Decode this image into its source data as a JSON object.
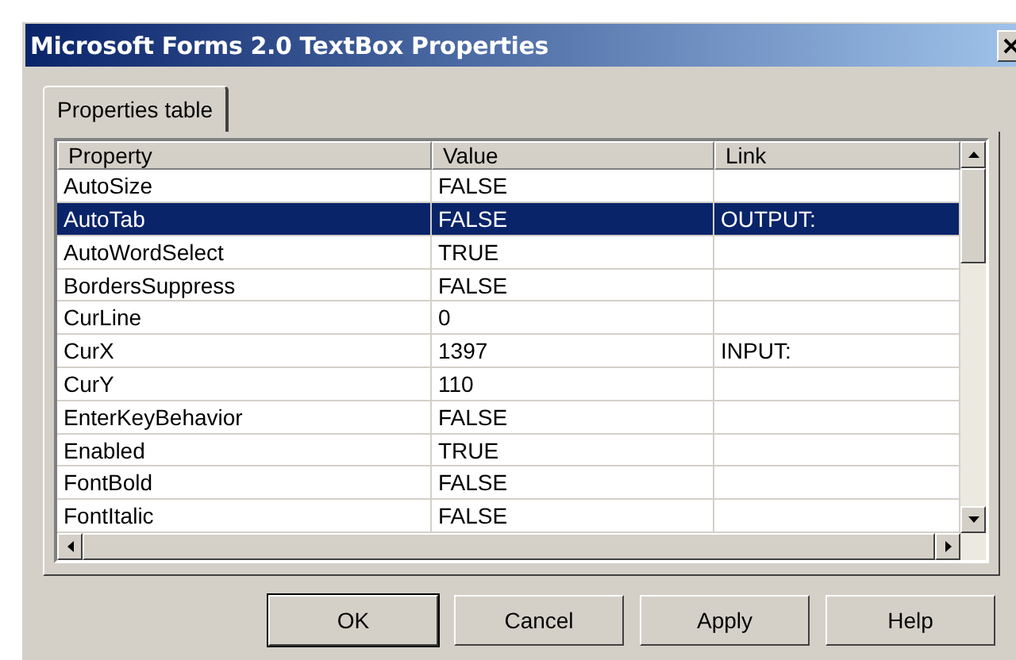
{
  "window": {
    "title": "Microsoft Forms 2.0 TextBox Properties"
  },
  "tabs": [
    {
      "label": "Properties table",
      "selected": true
    }
  ],
  "table": {
    "columns": [
      "Property",
      "Value",
      "Link"
    ],
    "rows": [
      {
        "property": "AutoSize",
        "value": "FALSE",
        "link": "",
        "selected": false
      },
      {
        "property": "AutoTab",
        "value": "FALSE",
        "link": "OUTPUT:",
        "selected": true
      },
      {
        "property": "AutoWordSelect",
        "value": "TRUE",
        "link": "",
        "selected": false
      },
      {
        "property": "BordersSuppress",
        "value": "FALSE",
        "link": "",
        "selected": false
      },
      {
        "property": "CurLine",
        "value": "0",
        "link": "",
        "selected": false
      },
      {
        "property": "CurX",
        "value": "1397",
        "link": "INPUT:",
        "selected": false
      },
      {
        "property": "CurY",
        "value": "110",
        "link": "",
        "selected": false
      },
      {
        "property": "EnterKeyBehavior",
        "value": "FALSE",
        "link": "",
        "selected": false
      },
      {
        "property": "Enabled",
        "value": "TRUE",
        "link": "",
        "selected": false
      },
      {
        "property": "FontBold",
        "value": "FALSE",
        "link": "",
        "selected": false
      },
      {
        "property": "FontItalic",
        "value": "FALSE",
        "link": "",
        "selected": false
      }
    ]
  },
  "buttons": [
    {
      "label": "OK",
      "default": true
    },
    {
      "label": "Cancel",
      "default": false
    },
    {
      "label": "Apply",
      "default": false
    },
    {
      "label": "Help",
      "default": false
    }
  ]
}
